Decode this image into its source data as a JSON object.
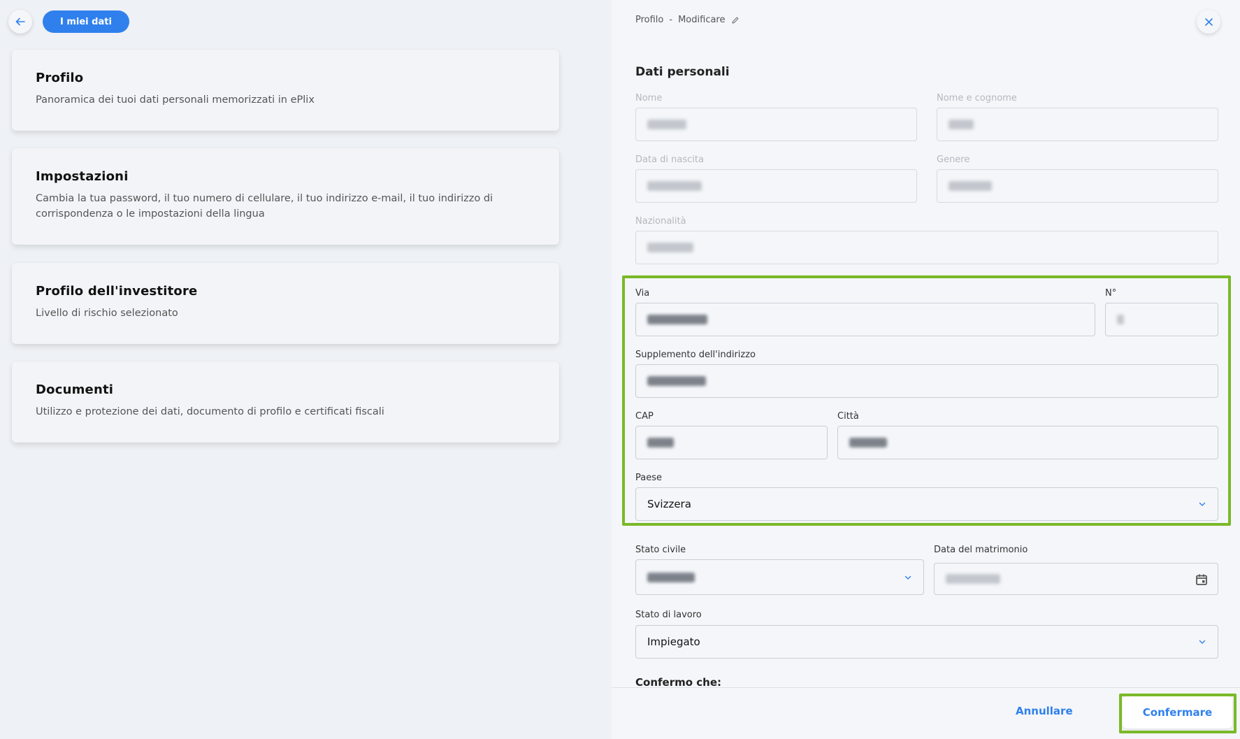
{
  "header": {
    "back_label": "back",
    "pill_label": "I miei dati"
  },
  "cards": [
    {
      "title": "Profilo",
      "desc": "Panoramica dei tuoi dati personali memorizzati in ePlix"
    },
    {
      "title": "Impostazioni",
      "desc": "Cambia la tua password, il tuo numero di cellulare, il tuo indirizzo e-mail, il tuo indirizzo di corrispondenza o le impostazioni della lingua"
    },
    {
      "title": "Profilo dell'investitore",
      "desc": "Livello di rischio selezionato"
    },
    {
      "title": "Documenti",
      "desc": "Utilizzo e protezione dei dati, documento di profilo e certificati fiscali"
    }
  ],
  "panel": {
    "breadcrumb_1": "Profilo",
    "breadcrumb_sep": "-",
    "breadcrumb_2": "Modificare",
    "section_title": "Dati personali"
  },
  "form": {
    "nome_label": "Nome",
    "nome_cognome_label": "Nome e cognome",
    "data_nascita_label": "Data di nascita",
    "genere_label": "Genere",
    "nazionalita_label": "Nazionalità",
    "via_label": "Via",
    "numero_label": "N°",
    "supplemento_label": "Supplemento dell'indirizzo",
    "cap_label": "CAP",
    "citta_label": "Città",
    "paese_label": "Paese",
    "paese_value": "Svizzera",
    "stato_civile_label": "Stato civile",
    "data_matrimonio_label": "Data del matrimonio",
    "stato_lavoro_label": "Stato di lavoro",
    "stato_lavoro_value": "Impiegato",
    "confermo_label": "Confermo che:"
  },
  "footer": {
    "cancel_label": "Annullare",
    "confirm_label": "Confermare"
  },
  "colors": {
    "accent": "#2f80ed",
    "highlight": "#7ab929"
  },
  "icons": {
    "back": "arrow-left-icon",
    "close": "close-icon",
    "edit": "pencil-icon",
    "dropdown": "chevron-down-icon",
    "calendar": "calendar-icon"
  }
}
